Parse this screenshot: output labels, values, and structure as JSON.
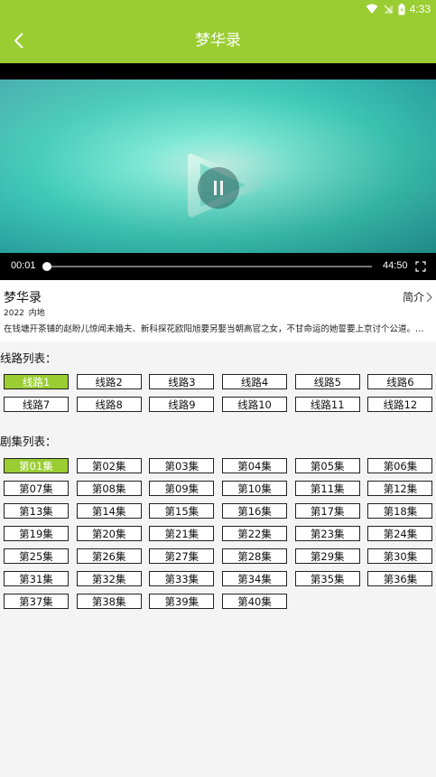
{
  "status": {
    "time": "4:33"
  },
  "header": {
    "title": "梦华录",
    "back_icon": "back-arrow-icon"
  },
  "player": {
    "current_time": "00:01",
    "duration": "44:50",
    "progress_fraction": 0.0004
  },
  "info": {
    "name": "梦华录",
    "intro_label": "简介",
    "meta": "2022 内地",
    "description": "在钱塘开茶铺的赵盼儿惊闻未婚夫、新科探花欧阳旭要另娶当朝高官之女，不甘命运的她誓要上京讨个公道。在途中她遇到"
  },
  "routes": {
    "label": "线路列表：",
    "active_index": 0,
    "items": [
      "线路1",
      "线路2",
      "线路3",
      "线路4",
      "线路5",
      "线路6",
      "线路7",
      "线路8",
      "线路9",
      "线路10",
      "线路11",
      "线路12"
    ]
  },
  "episodes": {
    "label": "剧集列表：",
    "active_index": 0,
    "items": [
      "第01集",
      "第02集",
      "第03集",
      "第04集",
      "第05集",
      "第06集",
      "第07集",
      "第08集",
      "第09集",
      "第10集",
      "第11集",
      "第12集",
      "第13集",
      "第14集",
      "第15集",
      "第16集",
      "第17集",
      "第18集",
      "第19集",
      "第20集",
      "第21集",
      "第22集",
      "第23集",
      "第24集",
      "第25集",
      "第26集",
      "第27集",
      "第28集",
      "第29集",
      "第30集",
      "第31集",
      "第32集",
      "第33集",
      "第34集",
      "第35集",
      "第36集",
      "第37集",
      "第38集",
      "第39集",
      "第40集"
    ]
  },
  "colors": {
    "accent": "#9acd32"
  }
}
